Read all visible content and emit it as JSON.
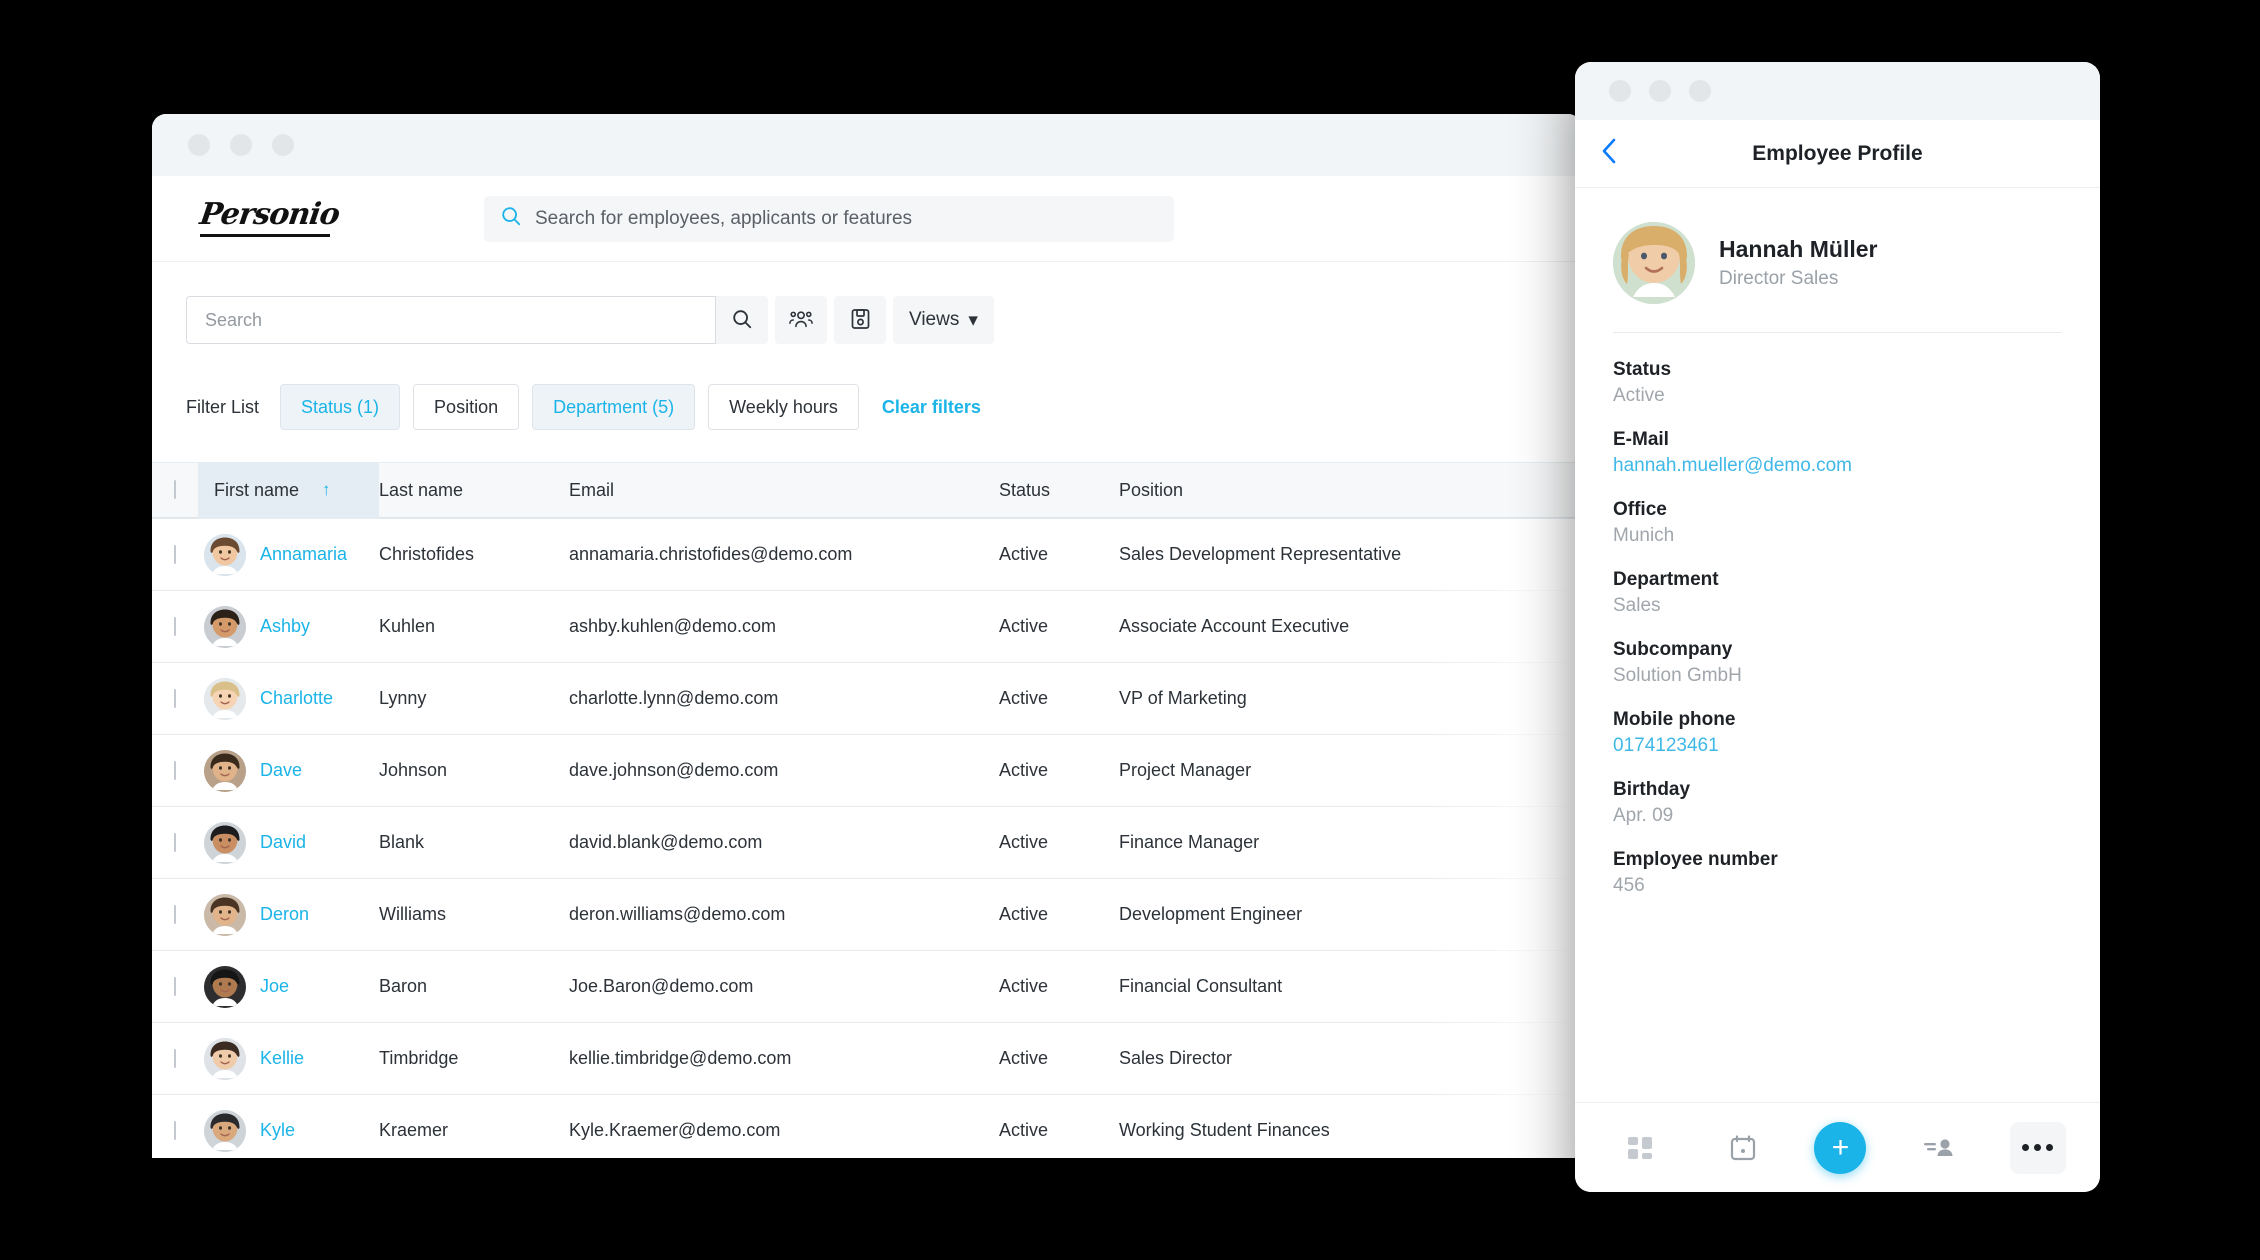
{
  "colors": {
    "accent_cyan": "#1bb4e8",
    "link_blue": "#0a7aff",
    "chip_active_bg": "#eef3f7",
    "sorted_col_bg": "#e3edf3",
    "page_bg": "#000000"
  },
  "desktop": {
    "brand": {
      "logo_text": "Personio"
    },
    "global_search": {
      "placeholder": "Search for employees, applicants or features",
      "icon": "search-icon"
    },
    "toolbar": {
      "search_placeholder": "Search",
      "search_value": "",
      "buttons": [
        {
          "name": "search-button",
          "icon": "search-icon"
        },
        {
          "name": "group-button",
          "icon": "people-group-icon"
        },
        {
          "name": "save-button",
          "icon": "floppy-disk-icon"
        }
      ],
      "views_label": "Views",
      "views_caret": "▾"
    },
    "filters": {
      "label": "Filter List",
      "chips": [
        {
          "label": "Status (1)",
          "active": true
        },
        {
          "label": "Position",
          "active": false
        },
        {
          "label": "Department (5)",
          "active": true
        },
        {
          "label": "Weekly hours",
          "active": false
        }
      ],
      "clear_label": "Clear filters"
    },
    "table": {
      "columns": [
        "First name",
        "Last name",
        "Email",
        "Status",
        "Position"
      ],
      "sorted_column": "First name",
      "sort_direction": "↑",
      "rows": [
        {
          "first": "Annamaria",
          "last": "Christofides",
          "email": "annamaria.christofides@demo.com",
          "status": "Active",
          "position": "Sales Development Representative"
        },
        {
          "first": "Ashby",
          "last": "Kuhlen",
          "email": "ashby.kuhlen@demo.com",
          "status": "Active",
          "position": "Associate Account Executive"
        },
        {
          "first": "Charlotte",
          "last": "Lynny",
          "email": "charlotte.lynn@demo.com",
          "status": "Active",
          "position": "VP of Marketing"
        },
        {
          "first": "Dave",
          "last": "Johnson",
          "email": "dave.johnson@demo.com",
          "status": "Active",
          "position": "Project Manager"
        },
        {
          "first": "David",
          "last": "Blank",
          "email": "david.blank@demo.com",
          "status": "Active",
          "position": "Finance Manager"
        },
        {
          "first": "Deron",
          "last": "Williams",
          "email": "deron.williams@demo.com",
          "status": "Active",
          "position": "Development Engineer"
        },
        {
          "first": "Joe",
          "last": "Baron",
          "email": "Joe.Baron@demo.com",
          "status": "Active",
          "position": "Financial Consultant"
        },
        {
          "first": "Kellie",
          "last": "Timbridge",
          "email": "kellie.timbridge@demo.com",
          "status": "Active",
          "position": "Sales Director"
        },
        {
          "first": "Kyle",
          "last": "Kraemer",
          "email": "Kyle.Kraemer@demo.com",
          "status": "Active",
          "position": "Working Student Finances"
        }
      ]
    }
  },
  "phone": {
    "nav": {
      "back_icon": "chevron-left-icon",
      "title": "Employee Profile"
    },
    "person": {
      "name": "Hannah Müller",
      "role": "Director Sales"
    },
    "fields": [
      {
        "label": "Status",
        "value": "Active",
        "is_link": false
      },
      {
        "label": "E-Mail",
        "value": "hannah.mueller@demo.com",
        "is_link": true
      },
      {
        "label": "Office",
        "value": "Munich",
        "is_link": false
      },
      {
        "label": "Department",
        "value": "Sales",
        "is_link": false
      },
      {
        "label": "Subcompany",
        "value": "Solution GmbH",
        "is_link": false
      },
      {
        "label": "Mobile phone",
        "value": "0174123461",
        "is_link": true
      },
      {
        "label": "Birthday",
        "value": "Apr. 09",
        "is_link": false
      },
      {
        "label": "Employee number",
        "value": "456",
        "is_link": false
      }
    ],
    "tabbar": [
      {
        "name": "dashboard-grid-icon"
      },
      {
        "name": "calendar-icon"
      },
      {
        "name": "add-plus-icon",
        "label": "+"
      },
      {
        "name": "people-list-icon"
      },
      {
        "name": "more-dots-icon"
      }
    ]
  }
}
